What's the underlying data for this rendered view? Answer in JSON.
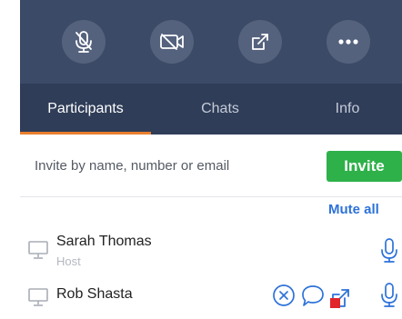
{
  "toolbar": {
    "buttons": [
      {
        "name": "mute-mic",
        "icon": "microphone-off-icon"
      },
      {
        "name": "stop-video",
        "icon": "video-off-icon"
      },
      {
        "name": "share",
        "icon": "share-icon"
      },
      {
        "name": "more",
        "icon": "more-icon"
      }
    ]
  },
  "tabs": [
    {
      "label": "Participants",
      "active": true
    },
    {
      "label": "Chats",
      "active": false
    },
    {
      "label": "Info",
      "active": false
    }
  ],
  "invite": {
    "placeholder": "Invite by name, number or email",
    "button_label": "Invite"
  },
  "mute_all_label": "Mute all",
  "participants": [
    {
      "name": "Sarah Thomas",
      "role": "Host",
      "device_icon": "computer-icon",
      "actions": [
        "microphone-icon"
      ]
    },
    {
      "name": "Rob Shasta",
      "role": "",
      "device_icon": "computer-icon",
      "actions": [
        "remove-icon",
        "chat-icon",
        "share-icon",
        "microphone-icon"
      ]
    }
  ],
  "colors": {
    "toolbar_bg": "#3b4a66",
    "tab_bg": "#2f3d58",
    "accent_underline": "#e87f2e",
    "invite_green": "#2fb14a",
    "link_blue": "#2d72d9",
    "share_badge_red": "#e0242a"
  }
}
